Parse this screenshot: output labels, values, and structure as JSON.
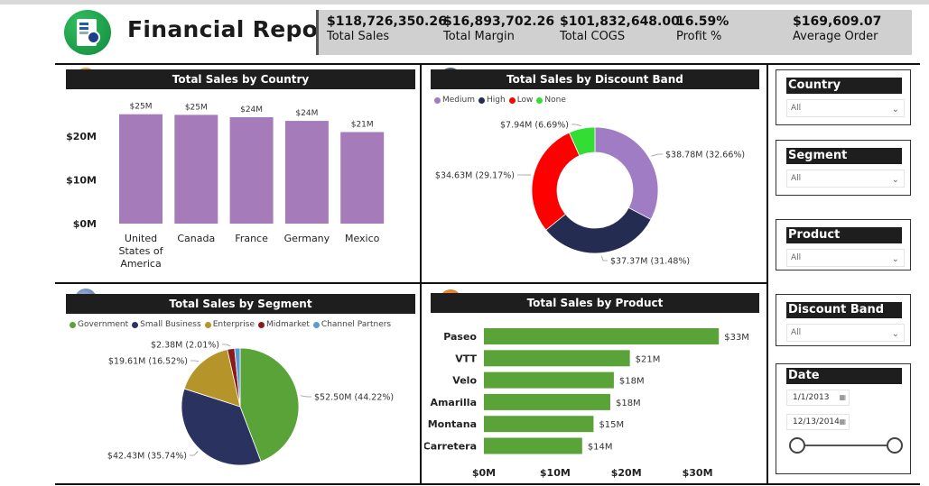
{
  "app_title": "Financial Report",
  "kpis": [
    {
      "value": "$118,726,350.26",
      "label": "Total Sales"
    },
    {
      "value": "$16,893,702.26",
      "label": "Total Margin"
    },
    {
      "value": "$101,832,648.00",
      "label": "Total COGS"
    },
    {
      "value": "16.59%",
      "label": "Profit %"
    },
    {
      "value": "$169,609.07",
      "label": "Average Order"
    }
  ],
  "panels": {
    "country": {
      "title": "Total Sales by Country"
    },
    "discount": {
      "title": "Total Sales by Discount Band"
    },
    "segment": {
      "title": "Total Sales by Segment"
    },
    "product": {
      "title": "Total Sales by Product"
    }
  },
  "colors": {
    "country_bar": "#a67bba",
    "product_bar": "#5aa339",
    "medium": "#a07cc5",
    "high": "#252c52",
    "low": "#ff0000",
    "none": "#33dd33",
    "government": "#5aa339",
    "small_business": "#2a3360",
    "enterprise": "#b5952a",
    "midmarket": "#8b1a1a",
    "channel_partners": "#5b9bd5"
  },
  "legends": {
    "discount": [
      {
        "label": "Medium",
        "color": "#a07cc5"
      },
      {
        "label": "High",
        "color": "#252c52"
      },
      {
        "label": "Low",
        "color": "#ff0000"
      },
      {
        "label": "None",
        "color": "#33dd33"
      }
    ],
    "segment": [
      {
        "label": "Government",
        "color": "#5aa339"
      },
      {
        "label": "Small Business",
        "color": "#2a3360"
      },
      {
        "label": "Enterprise",
        "color": "#b5952a"
      },
      {
        "label": "Midmarket",
        "color": "#8b1a1a"
      },
      {
        "label": "Channel Partners",
        "color": "#5b9bd5"
      }
    ]
  },
  "slicers": {
    "country": {
      "title": "Country",
      "value": "All"
    },
    "segment": {
      "title": "Segment",
      "value": "All"
    },
    "product": {
      "title": "Product",
      "value": "All"
    },
    "discount": {
      "title": "Discount Band",
      "value": "All"
    },
    "date": {
      "title": "Date",
      "start": "1/1/2013",
      "end": "12/13/2014"
    }
  },
  "chart_data": [
    {
      "id": "country",
      "type": "bar",
      "title": "Total Sales by Country",
      "categories": [
        "United States of America",
        "Canada",
        "France",
        "Germany",
        "Mexico"
      ],
      "category_lines": [
        [
          "United",
          "States of",
          "America"
        ],
        [
          "Canada"
        ],
        [
          "France"
        ],
        [
          "Germany"
        ],
        [
          "Mexico"
        ]
      ],
      "values": [
        25.03,
        24.89,
        24.35,
        23.51,
        20.95
      ],
      "data_labels": [
        "$25M",
        "$25M",
        "$24M",
        "$24M",
        "$21M"
      ],
      "yticks": [
        0,
        10,
        20
      ],
      "ytick_labels": [
        "$0M",
        "$10M",
        "$20M"
      ],
      "ylim": [
        0,
        26
      ],
      "grid": false
    },
    {
      "id": "discount",
      "type": "pie",
      "donut": true,
      "title": "Total Sales by Discount Band",
      "labels": [
        "Medium",
        "High",
        "Low",
        "None"
      ],
      "values": [
        38.78,
        37.37,
        34.63,
        7.94
      ],
      "data_labels": [
        "$38.78M (32.66%)",
        "$37.37M (31.48%)",
        "$34.63M (29.17%)",
        "$7.94M (6.69%)"
      ],
      "legend": "top-left"
    },
    {
      "id": "segment",
      "type": "pie",
      "donut": false,
      "title": "Total Sales by Segment",
      "labels": [
        "Government",
        "Small Business",
        "Enterprise",
        "Midmarket",
        "Channel Partners"
      ],
      "values": [
        52.5,
        42.43,
        19.61,
        2.38,
        1.8
      ],
      "data_labels": [
        "$52.50M (44.22%)",
        "$42.43M (35.74%)",
        "$19.61M (16.52%)",
        "$2.38M (2.01%)",
        ""
      ],
      "legend": "top-left"
    },
    {
      "id": "product",
      "type": "bar",
      "orientation": "horizontal",
      "title": "Total Sales by Product",
      "categories": [
        "Paseo",
        "VTT",
        "Velo",
        "Amarilla",
        "Montana",
        "Carretera"
      ],
      "values": [
        33.0,
        20.5,
        18.25,
        17.75,
        15.4,
        13.8
      ],
      "data_labels": [
        "$33M",
        "$21M",
        "$18M",
        "$18M",
        "$15M",
        "$14M"
      ],
      "xticks": [
        0,
        10,
        20,
        30
      ],
      "xtick_labels": [
        "$0M",
        "$10M",
        "$20M",
        "$30M"
      ],
      "xlim": [
        0,
        35
      ],
      "grid": false
    }
  ]
}
